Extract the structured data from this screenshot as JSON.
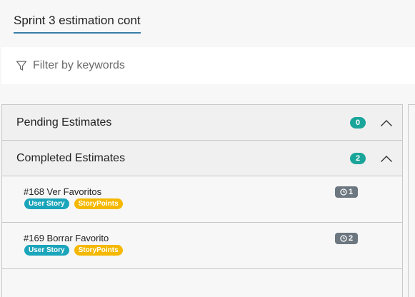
{
  "title": {
    "label": "Sprint 3 estimation cont"
  },
  "filter": {
    "placeholder": "Filter by keywords",
    "icon": "filter-icon"
  },
  "sections": [
    {
      "label": "Pending Estimates",
      "count": "0",
      "icon": "chevron-up-icon"
    },
    {
      "label": "Completed Estimates",
      "count": "2",
      "icon": "chevron-up-icon",
      "items": [
        {
          "title": "#168 Ver Favoritos",
          "tags": [
            "User Story",
            "StoryPoints"
          ],
          "estimate": "1"
        },
        {
          "title": "#169 Borrar Favorito",
          "tags": [
            "User Story",
            "StoryPoints"
          ],
          "estimate": "2"
        }
      ]
    }
  ],
  "colors": {
    "accent_underline": "#3a7ca8",
    "count_badge": "#1aa59a",
    "tag_user_story": "#1ba5bb",
    "tag_story_points": "#f5b800",
    "estimate_badge": "#6c7780"
  }
}
